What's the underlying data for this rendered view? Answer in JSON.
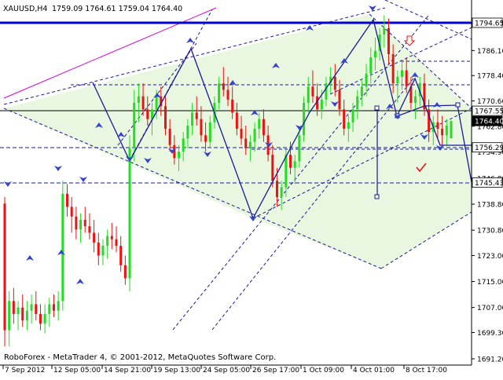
{
  "app": {
    "symbol_header": "XAUUSD,H4",
    "ohlc_header": "1759.09 1764.61 1759.04 1764.40",
    "copyright": "RoboForex - MetaTrader 4, © 2001-2012, MetaQuotes Software Corp."
  },
  "colors": {
    "background": "#ffffff",
    "bull": "#22dd22",
    "bear": "#ee1111",
    "trendline": "#1a1a99",
    "level": "#0000cc",
    "magenta": "#dd00dd",
    "fractal": "#3344cc",
    "triangle_fill": "#eaf7e0",
    "check_mark": "#ee1111",
    "label_bg": "#ffffff"
  },
  "icons": {
    "fractal_up": "fractal-up-arrow-icon",
    "fractal_down": "fractal-down-arrow-icon",
    "target_arrow": "outlined-down-arrow-icon",
    "check": "check-mark-icon"
  },
  "chart_data": {
    "type": "candlestick",
    "symbol": "XAUUSD",
    "timeframe": "H4",
    "price_ticks": [
      "1794.65",
      "1786.10",
      "1778.40",
      "1770.60",
      "1762.80",
      "1754.90",
      "1746.80",
      "1738.80",
      "1730.80",
      "1723.00",
      "1715.00",
      "1707.00",
      "1699.30",
      "1691.20"
    ],
    "price_tick_values": [
      1794.65,
      1786.1,
      1778.4,
      1770.6,
      1762.8,
      1754.9,
      1746.8,
      1738.8,
      1730.8,
      1723.0,
      1715.0,
      1707.0,
      1699.3,
      1691.2
    ],
    "time_ticks": [
      "7 Sep 2012",
      "12 Sep 05:00",
      "14 Sep 21:00",
      "19 Sep 13:00",
      "24 Sep 05:00",
      "26 Sep 17:00",
      "1 Oct 09:00",
      "4 Oct 01:00",
      "8 Oct 17:00"
    ],
    "ylim": [
      1689.0,
      1798.0
    ],
    "levels": [
      {
        "price": 1794.65,
        "label": "1794.65",
        "style": "solid-thick"
      },
      {
        "price": 1767.55,
        "label": "1767.55",
        "style": "solid"
      },
      {
        "price": 1764.4,
        "label": "1764.40",
        "style": "current"
      },
      {
        "price": 1756.29,
        "label": "1756.29",
        "style": "dashed"
      },
      {
        "price": 1745.43,
        "label": "1745.43",
        "style": "dashed"
      }
    ],
    "candles": [
      [
        1739,
        1741,
        1695,
        1700
      ],
      [
        1700,
        1712,
        1695,
        1709
      ],
      [
        1709,
        1713,
        1702,
        1705
      ],
      [
        1705,
        1709,
        1700,
        1707
      ],
      [
        1707,
        1711,
        1701,
        1703
      ],
      [
        1703,
        1709,
        1700,
        1706
      ],
      [
        1706,
        1711,
        1702,
        1708
      ],
      [
        1708,
        1712,
        1703,
        1705
      ],
      [
        1705,
        1708,
        1700,
        1702
      ],
      [
        1702,
        1708,
        1699,
        1705
      ],
      [
        1705,
        1710,
        1701,
        1708
      ],
      [
        1708,
        1711,
        1704,
        1706
      ],
      [
        1706,
        1712,
        1703,
        1709
      ],
      [
        1709,
        1746,
        1706,
        1742
      ],
      [
        1742,
        1745,
        1735,
        1738
      ],
      [
        1738,
        1741,
        1730,
        1735
      ],
      [
        1735,
        1738,
        1728,
        1731
      ],
      [
        1731,
        1736,
        1727,
        1734
      ],
      [
        1734,
        1738,
        1730,
        1732
      ],
      [
        1732,
        1736,
        1728,
        1730
      ],
      [
        1730,
        1734,
        1724,
        1727
      ],
      [
        1727,
        1730,
        1720,
        1723
      ],
      [
        1723,
        1728,
        1720,
        1726
      ],
      [
        1726,
        1731,
        1722,
        1729
      ],
      [
        1729,
        1733,
        1725,
        1728
      ],
      [
        1728,
        1732,
        1724,
        1726
      ],
      [
        1726,
        1729,
        1718,
        1720
      ],
      [
        1720,
        1723,
        1714,
        1716
      ],
      [
        1716,
        1760,
        1712,
        1756
      ],
      [
        1756,
        1774,
        1752,
        1770
      ],
      [
        1770,
        1776,
        1764,
        1772
      ],
      [
        1772,
        1776,
        1766,
        1768
      ],
      [
        1768,
        1772,
        1763,
        1765
      ],
      [
        1765,
        1770,
        1760,
        1768
      ],
      [
        1768,
        1774,
        1765,
        1772
      ],
      [
        1772,
        1775,
        1766,
        1769
      ],
      [
        1769,
        1772,
        1760,
        1762
      ],
      [
        1762,
        1765,
        1755,
        1757
      ],
      [
        1757,
        1760,
        1751,
        1753
      ],
      [
        1753,
        1757,
        1749,
        1755
      ],
      [
        1755,
        1761,
        1752,
        1759
      ],
      [
        1759,
        1765,
        1756,
        1763
      ],
      [
        1763,
        1770,
        1760,
        1767
      ],
      [
        1767,
        1772,
        1763,
        1765
      ],
      [
        1765,
        1769,
        1758,
        1760
      ],
      [
        1760,
        1764,
        1755,
        1758
      ],
      [
        1758,
        1766,
        1756,
        1764
      ],
      [
        1764,
        1772,
        1762,
        1770
      ],
      [
        1770,
        1778,
        1768,
        1776
      ],
      [
        1776,
        1781,
        1772,
        1774
      ],
      [
        1774,
        1778,
        1769,
        1771
      ],
      [
        1771,
        1775,
        1765,
        1767
      ],
      [
        1767,
        1770,
        1760,
        1762
      ],
      [
        1762,
        1766,
        1757,
        1759
      ],
      [
        1759,
        1763,
        1754,
        1756
      ],
      [
        1756,
        1760,
        1752,
        1758
      ],
      [
        1758,
        1764,
        1755,
        1762
      ],
      [
        1762,
        1767,
        1759,
        1765
      ],
      [
        1765,
        1768,
        1758,
        1760
      ],
      [
        1760,
        1763,
        1752,
        1754
      ],
      [
        1754,
        1757,
        1744,
        1746
      ],
      [
        1746,
        1750,
        1738,
        1741
      ],
      [
        1741,
        1746,
        1737,
        1744
      ],
      [
        1744,
        1756,
        1741,
        1754
      ],
      [
        1754,
        1758,
        1748,
        1750
      ],
      [
        1750,
        1754,
        1745,
        1752
      ],
      [
        1752,
        1762,
        1750,
        1760
      ],
      [
        1760,
        1772,
        1758,
        1770
      ],
      [
        1770,
        1778,
        1767,
        1775
      ],
      [
        1775,
        1780,
        1770,
        1772
      ],
      [
        1772,
        1776,
        1766,
        1768
      ],
      [
        1768,
        1774,
        1765,
        1771
      ],
      [
        1771,
        1778,
        1769,
        1776
      ],
      [
        1776,
        1781,
        1773,
        1778
      ],
      [
        1778,
        1782,
        1772,
        1774
      ],
      [
        1774,
        1777,
        1766,
        1768
      ],
      [
        1768,
        1771,
        1760,
        1762
      ],
      [
        1762,
        1766,
        1758,
        1764
      ],
      [
        1764,
        1770,
        1761,
        1768
      ],
      [
        1768,
        1774,
        1765,
        1772
      ],
      [
        1772,
        1777,
        1769,
        1775
      ],
      [
        1775,
        1782,
        1772,
        1779
      ],
      [
        1779,
        1787,
        1776,
        1784
      ],
      [
        1784,
        1790,
        1780,
        1786
      ],
      [
        1786,
        1793,
        1783,
        1791
      ],
      [
        1791,
        1797,
        1787,
        1793
      ],
      [
        1793,
        1796,
        1782,
        1785
      ],
      [
        1785,
        1788,
        1773,
        1776
      ],
      [
        1776,
        1780,
        1770,
        1778
      ],
      [
        1778,
        1783,
        1774,
        1780
      ],
      [
        1780,
        1784,
        1773,
        1775
      ],
      [
        1775,
        1778,
        1768,
        1770
      ],
      [
        1770,
        1774,
        1765,
        1772
      ],
      [
        1772,
        1778,
        1769,
        1776
      ],
      [
        1776,
        1779,
        1766,
        1768
      ],
      [
        1768,
        1771,
        1758,
        1761
      ],
      [
        1761,
        1766,
        1757,
        1764
      ],
      [
        1764,
        1768,
        1759,
        1762
      ],
      [
        1762,
        1766,
        1757,
        1760
      ],
      [
        1760,
        1765,
        1757,
        1763
      ],
      [
        1759.09,
        1764.61,
        1759.04,
        1764.4
      ]
    ]
  }
}
